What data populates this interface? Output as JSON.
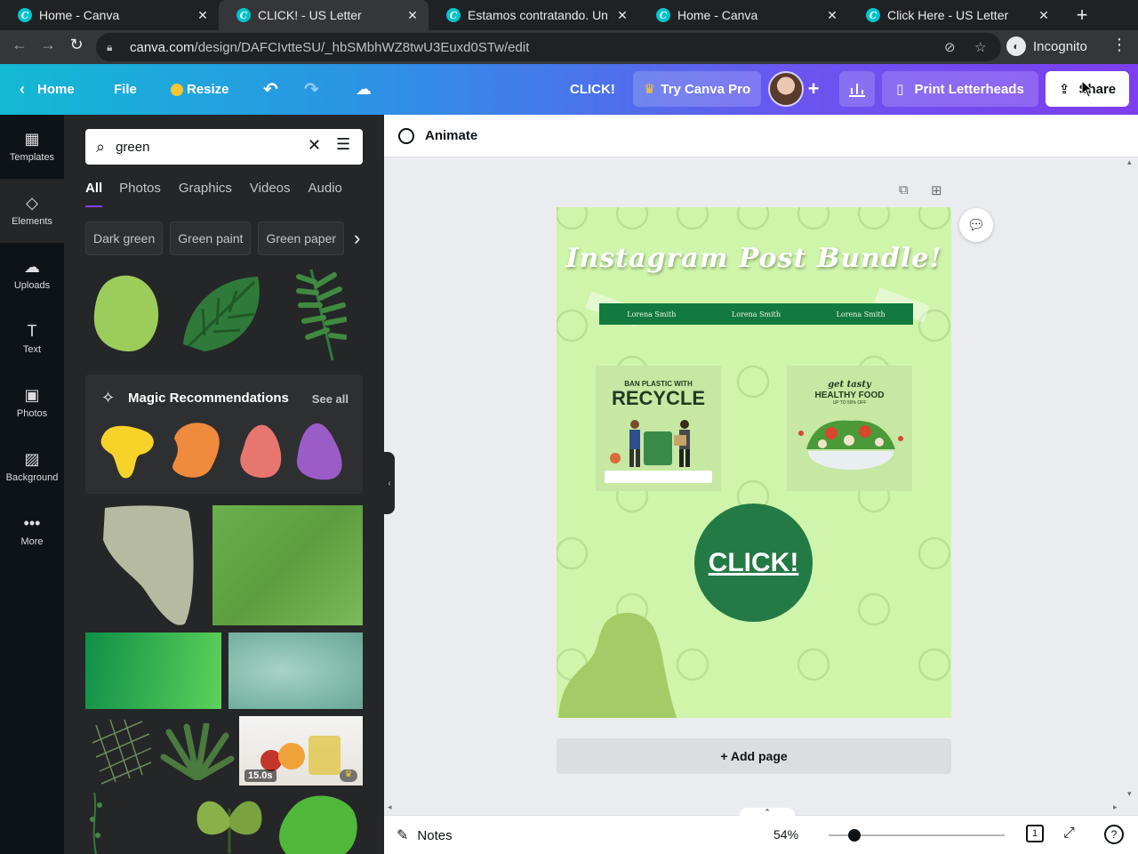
{
  "browser": {
    "tabs": [
      {
        "title": "Home - Canva",
        "active": false
      },
      {
        "title": "CLICK! - US Letter",
        "active": true
      },
      {
        "title": "Estamos contratando. Une",
        "active": false
      },
      {
        "title": "Home - Canva",
        "active": false
      },
      {
        "title": "Click Here - US Letter",
        "active": false
      }
    ],
    "url_domain": "canva.com",
    "url_path": "/design/DAFCIvtteSU/_hbSMbhWZ8twU3Euxd0STw/edit",
    "incognito_label": "Incognito"
  },
  "header": {
    "home": "Home",
    "file": "File",
    "resize": "Resize",
    "design_title": "CLICK!",
    "try_pro": "Try Canva Pro",
    "print": "Print Letterheads",
    "share": "Share"
  },
  "rail": [
    {
      "label": "Templates",
      "icon": "templates-icon"
    },
    {
      "label": "Elements",
      "icon": "elements-icon",
      "active": true
    },
    {
      "label": "Uploads",
      "icon": "uploads-icon"
    },
    {
      "label": "Text",
      "icon": "text-icon"
    },
    {
      "label": "Photos",
      "icon": "photos-icon"
    },
    {
      "label": "Background",
      "icon": "background-icon"
    },
    {
      "label": "More",
      "icon": "more-icon"
    }
  ],
  "panel": {
    "search_value": "green",
    "tabs": [
      "All",
      "Photos",
      "Graphics",
      "Videos",
      "Audio"
    ],
    "chips": [
      "Dark green",
      "Green paint",
      "Green paper"
    ],
    "magic_title": "Magic Recommendations",
    "see_all": "See all",
    "video_duration": "15.0s"
  },
  "workspace": {
    "animate": "Animate",
    "page_title": "Instagram Post Bundle!",
    "ribbon_names": [
      "Lorena Smith",
      "Lorena Smith",
      "Lorena Smith"
    ],
    "card1_line1": "BAN PLASTIC WITH",
    "card1_line2": "RECYCLE",
    "card2_line1": "get tasty",
    "card2_line2": "HEALTHY FOOD",
    "card2_line3": "UP TO 50% OFF",
    "click_text": "CLICK!",
    "add_page": "+ Add page"
  },
  "footer": {
    "notes": "Notes",
    "zoom": "54%",
    "zoom_fraction": 0.54,
    "page_count": "1"
  },
  "colors": {
    "page_bg": "#cff5aa",
    "accent_green": "#247a45",
    "brand_purple": "#7d3df0"
  }
}
